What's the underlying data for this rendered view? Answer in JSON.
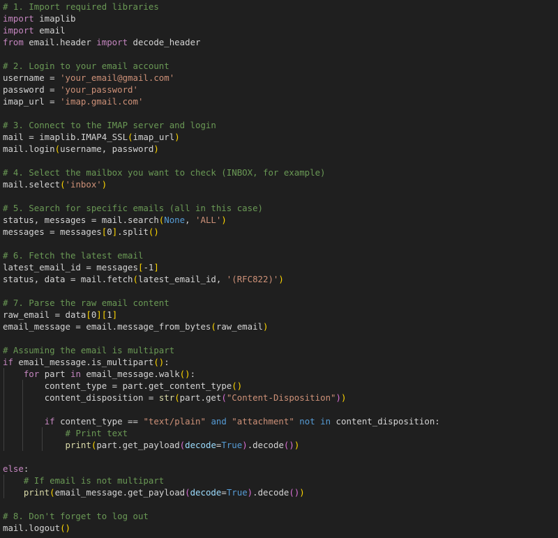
{
  "editor": {
    "colors": {
      "background": "#1f1f1f",
      "text": "#d4d4d4",
      "comment": "#6a9955",
      "keyword": "#c586c0",
      "string": "#ce9178",
      "builtin": "#dcdcaa",
      "constant": "#569cd6",
      "parameter": "#9cdcfe",
      "bracket_level1": "#ffd700",
      "bracket_level2": "#da70d6",
      "bracket_level3": "#179fff",
      "indent_guide": "#404040"
    },
    "lines": [
      {
        "indent": 0,
        "tokens": [
          [
            "comment",
            "# 1. Import required libraries"
          ]
        ]
      },
      {
        "indent": 0,
        "tokens": [
          [
            "keyword",
            "import"
          ],
          [
            "plain",
            " imaplib"
          ]
        ]
      },
      {
        "indent": 0,
        "tokens": [
          [
            "keyword",
            "import"
          ],
          [
            "plain",
            " email"
          ]
        ]
      },
      {
        "indent": 0,
        "tokens": [
          [
            "keyword",
            "from"
          ],
          [
            "plain",
            " email.header "
          ],
          [
            "keyword",
            "import"
          ],
          [
            "plain",
            " decode_header"
          ]
        ]
      },
      {
        "indent": 0,
        "tokens": []
      },
      {
        "indent": 0,
        "tokens": [
          [
            "comment",
            "# 2. Login to your email account"
          ]
        ]
      },
      {
        "indent": 0,
        "tokens": [
          [
            "plain",
            "username = "
          ],
          [
            "string",
            "'your_email@gmail.com'"
          ]
        ]
      },
      {
        "indent": 0,
        "tokens": [
          [
            "plain",
            "password = "
          ],
          [
            "string",
            "'your_password'"
          ]
        ]
      },
      {
        "indent": 0,
        "tokens": [
          [
            "plain",
            "imap_url = "
          ],
          [
            "string",
            "'imap.gmail.com'"
          ]
        ]
      },
      {
        "indent": 0,
        "tokens": []
      },
      {
        "indent": 0,
        "tokens": [
          [
            "comment",
            "# 3. Connect to the IMAP server and login"
          ]
        ]
      },
      {
        "indent": 0,
        "tokens": [
          [
            "plain",
            "mail = imaplib.IMAP4_SSL"
          ],
          [
            "bracket1",
            "("
          ],
          [
            "plain",
            "imap_url"
          ],
          [
            "bracket1",
            ")"
          ]
        ]
      },
      {
        "indent": 0,
        "tokens": [
          [
            "plain",
            "mail.login"
          ],
          [
            "bracket1",
            "("
          ],
          [
            "plain",
            "username, password"
          ],
          [
            "bracket1",
            ")"
          ]
        ]
      },
      {
        "indent": 0,
        "tokens": []
      },
      {
        "indent": 0,
        "tokens": [
          [
            "comment",
            "# 4. Select the mailbox you want to check (INBOX, for example)"
          ]
        ]
      },
      {
        "indent": 0,
        "tokens": [
          [
            "plain",
            "mail.select"
          ],
          [
            "bracket1",
            "("
          ],
          [
            "string",
            "'inbox'"
          ],
          [
            "bracket1",
            ")"
          ]
        ]
      },
      {
        "indent": 0,
        "tokens": []
      },
      {
        "indent": 0,
        "tokens": [
          [
            "comment",
            "# 5. Search for specific emails (all in this case)"
          ]
        ]
      },
      {
        "indent": 0,
        "tokens": [
          [
            "plain",
            "status, messages = mail.search"
          ],
          [
            "bracket1",
            "("
          ],
          [
            "const",
            "None"
          ],
          [
            "plain",
            ", "
          ],
          [
            "string",
            "'ALL'"
          ],
          [
            "bracket1",
            ")"
          ]
        ]
      },
      {
        "indent": 0,
        "tokens": [
          [
            "plain",
            "messages = messages"
          ],
          [
            "bracket1",
            "["
          ],
          [
            "plain",
            "0"
          ],
          [
            "bracket1",
            "]"
          ],
          [
            "plain",
            ".split"
          ],
          [
            "bracket1",
            "()"
          ]
        ]
      },
      {
        "indent": 0,
        "tokens": []
      },
      {
        "indent": 0,
        "tokens": [
          [
            "comment",
            "# 6. Fetch the latest email"
          ]
        ]
      },
      {
        "indent": 0,
        "tokens": [
          [
            "plain",
            "latest_email_id = messages"
          ],
          [
            "bracket1",
            "["
          ],
          [
            "plain",
            "-1"
          ],
          [
            "bracket1",
            "]"
          ]
        ]
      },
      {
        "indent": 0,
        "tokens": [
          [
            "plain",
            "status, data = mail.fetch"
          ],
          [
            "bracket1",
            "("
          ],
          [
            "plain",
            "latest_email_id, "
          ],
          [
            "string",
            "'(RFC822)'"
          ],
          [
            "bracket1",
            ")"
          ]
        ]
      },
      {
        "indent": 0,
        "tokens": []
      },
      {
        "indent": 0,
        "tokens": [
          [
            "comment",
            "# 7. Parse the raw email content"
          ]
        ]
      },
      {
        "indent": 0,
        "tokens": [
          [
            "plain",
            "raw_email = data"
          ],
          [
            "bracket1",
            "["
          ],
          [
            "plain",
            "0"
          ],
          [
            "bracket1",
            "]["
          ],
          [
            "plain",
            "1"
          ],
          [
            "bracket1",
            "]"
          ]
        ]
      },
      {
        "indent": 0,
        "tokens": [
          [
            "plain",
            "email_message = email.message_from_bytes"
          ],
          [
            "bracket1",
            "("
          ],
          [
            "plain",
            "raw_email"
          ],
          [
            "bracket1",
            ")"
          ]
        ]
      },
      {
        "indent": 0,
        "tokens": []
      },
      {
        "indent": 0,
        "tokens": [
          [
            "comment",
            "# Assuming the email is multipart"
          ]
        ]
      },
      {
        "indent": 0,
        "tokens": [
          [
            "keyword",
            "if"
          ],
          [
            "plain",
            " email_message.is_multipart"
          ],
          [
            "bracket1",
            "()"
          ],
          [
            "plain",
            ":"
          ]
        ]
      },
      {
        "indent": 1,
        "tokens": [
          [
            "keyword",
            "for"
          ],
          [
            "plain",
            " part "
          ],
          [
            "keyword",
            "in"
          ],
          [
            "plain",
            " email_message.walk"
          ],
          [
            "bracket1",
            "()"
          ],
          [
            "plain",
            ":"
          ]
        ]
      },
      {
        "indent": 2,
        "tokens": [
          [
            "plain",
            "content_type = part.get_content_type"
          ],
          [
            "bracket1",
            "()"
          ]
        ]
      },
      {
        "indent": 2,
        "tokens": [
          [
            "plain",
            "content_disposition = "
          ],
          [
            "builtin",
            "str"
          ],
          [
            "bracket1",
            "("
          ],
          [
            "plain",
            "part.get"
          ],
          [
            "bracket2",
            "("
          ],
          [
            "string",
            "\"Content-Disposition\""
          ],
          [
            "bracket2",
            ")"
          ],
          [
            "bracket1",
            ")"
          ]
        ]
      },
      {
        "indent": 2,
        "tokens": []
      },
      {
        "indent": 2,
        "tokens": [
          [
            "keyword",
            "if"
          ],
          [
            "plain",
            " content_type == "
          ],
          [
            "string",
            "\"text/plain\""
          ],
          [
            "plain",
            " "
          ],
          [
            "const",
            "and"
          ],
          [
            "plain",
            " "
          ],
          [
            "string",
            "\"attachment\""
          ],
          [
            "plain",
            " "
          ],
          [
            "const",
            "not"
          ],
          [
            "plain",
            " "
          ],
          [
            "const",
            "in"
          ],
          [
            "plain",
            " content_disposition:"
          ]
        ]
      },
      {
        "indent": 3,
        "tokens": [
          [
            "comment",
            "# Print text"
          ]
        ]
      },
      {
        "indent": 3,
        "tokens": [
          [
            "builtin",
            "print"
          ],
          [
            "bracket1",
            "("
          ],
          [
            "plain",
            "part.get_payload"
          ],
          [
            "bracket2",
            "("
          ],
          [
            "param",
            "decode"
          ],
          [
            "plain",
            "="
          ],
          [
            "const",
            "True"
          ],
          [
            "bracket2",
            ")"
          ],
          [
            "plain",
            ".decode"
          ],
          [
            "bracket2",
            "()"
          ],
          [
            "bracket1",
            ")"
          ]
        ]
      },
      {
        "indent": 0,
        "tokens": []
      },
      {
        "indent": 0,
        "tokens": [
          [
            "keyword",
            "else"
          ],
          [
            "plain",
            ":"
          ]
        ]
      },
      {
        "indent": 1,
        "tokens": [
          [
            "comment",
            "# If email is not multipart"
          ]
        ]
      },
      {
        "indent": 1,
        "tokens": [
          [
            "builtin",
            "print"
          ],
          [
            "bracket1",
            "("
          ],
          [
            "plain",
            "email_message.get_payload"
          ],
          [
            "bracket2",
            "("
          ],
          [
            "param",
            "decode"
          ],
          [
            "plain",
            "="
          ],
          [
            "const",
            "True"
          ],
          [
            "bracket2",
            ")"
          ],
          [
            "plain",
            ".decode"
          ],
          [
            "bracket2",
            "()"
          ],
          [
            "bracket1",
            ")"
          ]
        ]
      },
      {
        "indent": 0,
        "tokens": []
      },
      {
        "indent": 0,
        "tokens": [
          [
            "comment",
            "# 8. Don't forget to log out"
          ]
        ]
      },
      {
        "indent": 0,
        "tokens": [
          [
            "plain",
            "mail.logout"
          ],
          [
            "bracket1",
            "()"
          ]
        ]
      }
    ]
  }
}
